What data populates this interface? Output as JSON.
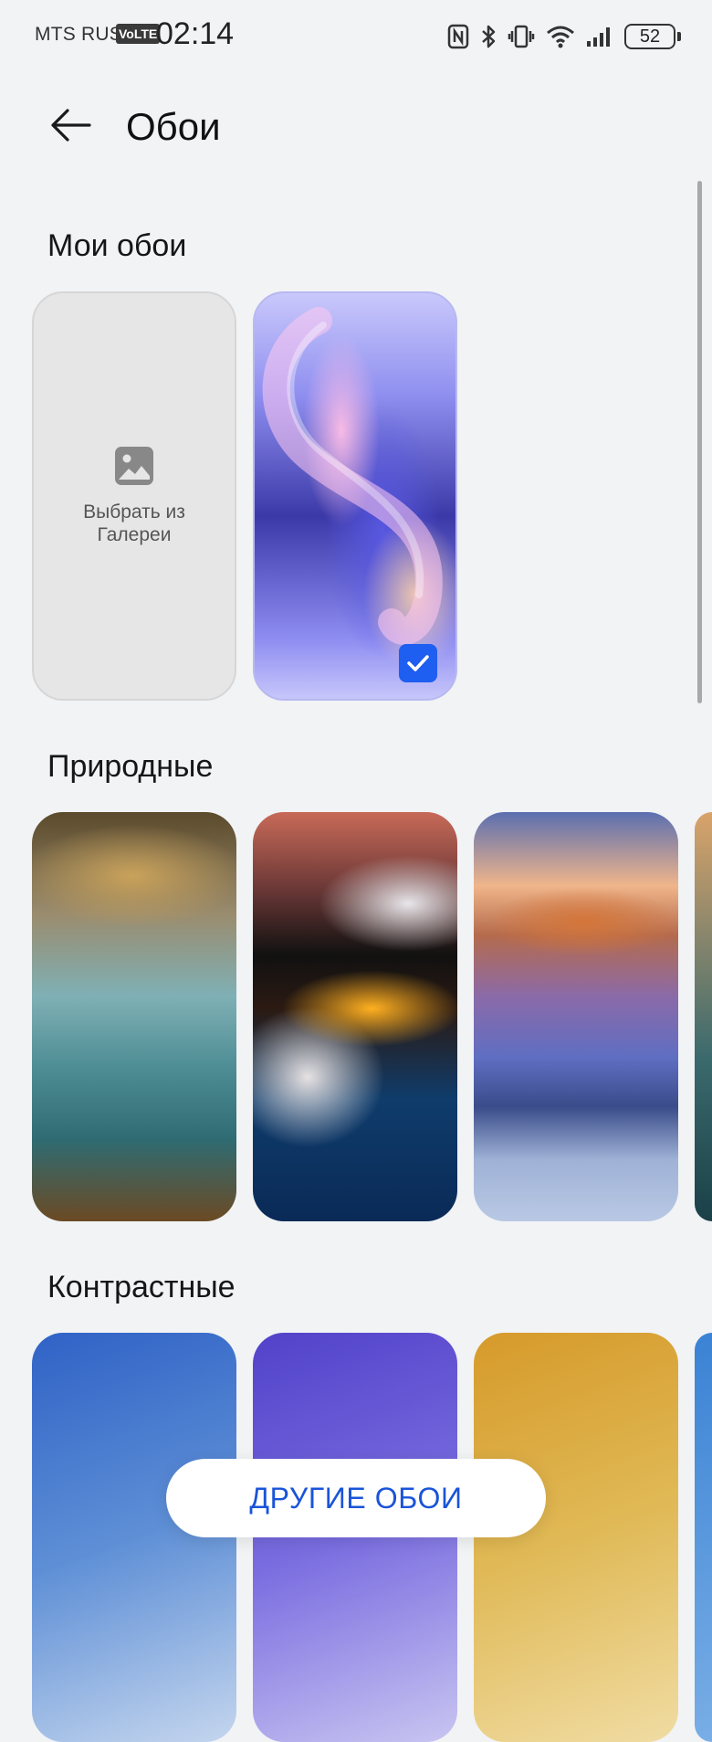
{
  "status_bar": {
    "carrier": "MTS RUS",
    "volte": "VoLTE",
    "time": "02:14",
    "battery": "52",
    "icons": [
      "nfc-icon",
      "bluetooth-icon",
      "vibrate-icon",
      "wifi-icon",
      "signal-icon",
      "battery-icon"
    ]
  },
  "header": {
    "title": "Обои"
  },
  "sections": {
    "my": {
      "title": "Мои обои",
      "gallery_label": "Выбрать из Галереи"
    },
    "nature": {
      "title": "Природные"
    },
    "contrast": {
      "title": "Контрастные"
    }
  },
  "cta": {
    "label": "ДРУГИЕ ОБОИ"
  },
  "colors": {
    "accent": "#1e5ef0",
    "cta_text": "#1a54d8",
    "background": "#f1f3f5"
  }
}
